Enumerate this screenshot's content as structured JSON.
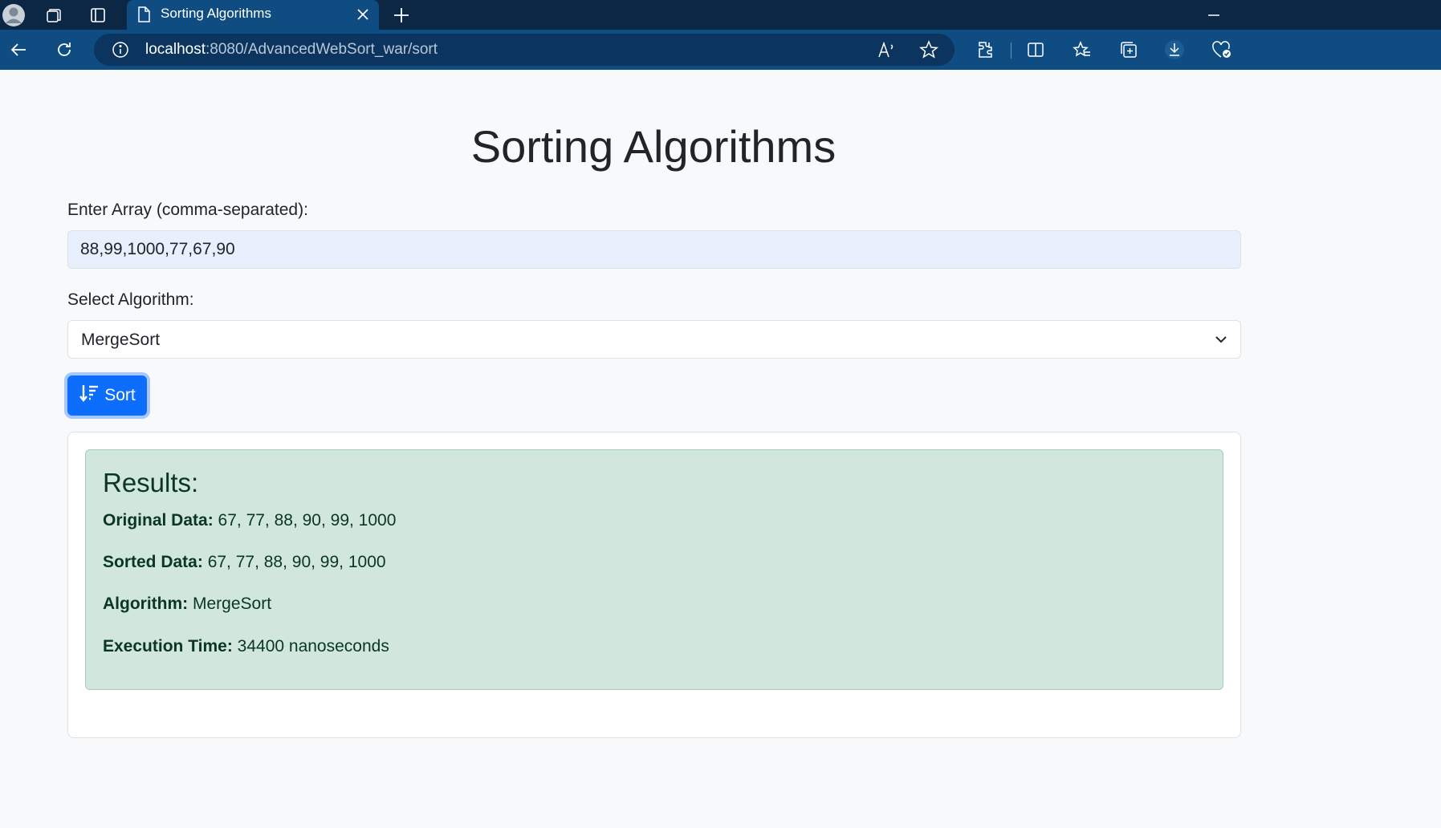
{
  "browser": {
    "tab_title": "Sorting Algorithms",
    "url_host": "localhost",
    "url_rest": ":8080/AdvancedWebSort_war/sort"
  },
  "page": {
    "title": "Sorting Algorithms",
    "array_label": "Enter Array (comma-separated):",
    "array_value": "88,99,1000,77,67,90",
    "algorithm_label": "Select Algorithm:",
    "algorithm_selected": "MergeSort",
    "sort_button": "Sort"
  },
  "results": {
    "heading": "Results:",
    "original_label": "Original Data:",
    "original_value": " 67, 77, 88, 90, 99, 1000",
    "sorted_label": "Sorted Data:",
    "sorted_value": " 67, 77, 88, 90, 99, 1000",
    "algorithm_label": "Algorithm:",
    "algorithm_value": " MergeSort",
    "time_label": "Execution Time:",
    "time_value": " 34400 nanoseconds"
  },
  "colors": {
    "primary": "#0d6efd",
    "success_bg": "#d1e7dd",
    "success_text": "#0a3622",
    "browser_toolbar": "#0f4c81"
  }
}
